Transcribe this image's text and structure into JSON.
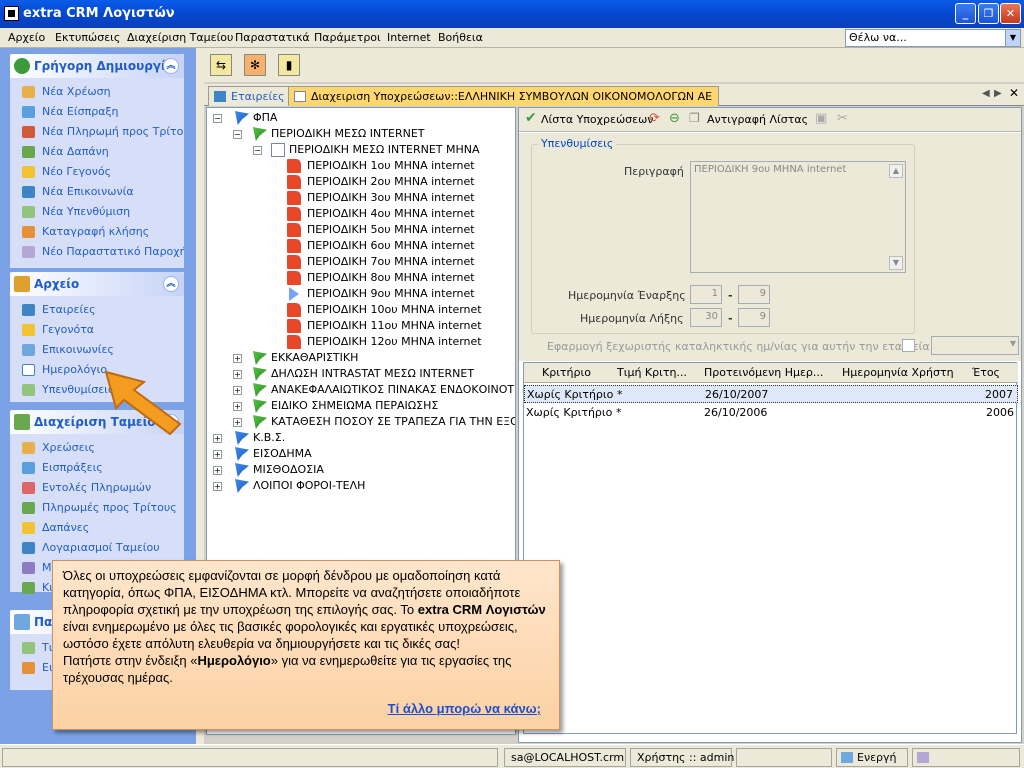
{
  "window": {
    "title": "extra CRM Λογιστών"
  },
  "menu": [
    "Αρχείο",
    "Εκτυπώσεις",
    "Διαχείριση Ταμείου",
    "Παραστατικά",
    "Παράμετροι",
    "Internet",
    "Βοήθεια"
  ],
  "search_combo": {
    "value": "Θέλω να..."
  },
  "panels": {
    "quick": {
      "title": "Γρήγορη Δημιουργία",
      "items": [
        "Νέα Χρέωση",
        "Νέα Είσπραξη",
        "Νέα Πληρωμή προς Τρίτους",
        "Νέα Δαπάνη",
        "Νέο Γεγονός",
        "Νέα Επικοινωνία",
        "Νέα Υπενθύμιση",
        "Καταγραφή κλήσης",
        "Νέο Παραστατικό Παροχής"
      ]
    },
    "archive": {
      "title": "Αρχείο",
      "items": [
        "Εταιρείες",
        "Γεγονότα",
        "Επικοινωνίες",
        "Ημερολόγιο",
        "Υπενθυμίσεις"
      ]
    },
    "treasury": {
      "title": "Διαχείριση Ταμείου",
      "items": [
        "Χρεώσεις",
        "Εισπράξεις",
        "Εντολές Πληρωμών",
        "Πληρωμές προς Τρίτους",
        "Δαπάνες",
        "Λογαριασμοί Ταμείου",
        "Μ",
        "Κι"
      ]
    },
    "fourth": {
      "title": "Πα",
      "items": [
        "Τι",
        "Ει"
      ]
    }
  },
  "tabs": {
    "companies": "Εταιρείες",
    "active": "Διαχειριση Υποχρεώσεων::ΕΛΛΗΝΙΚΗ ΣΥΜΒΟΥΛΩΝ ΟΙΚΟΝΟΜΟΛΟΓΩΝ ΑΕ"
  },
  "tree": {
    "root": "ΦΠΑ",
    "n1": "ΠΕΡΙΟΔΙΚΗ ΜΕΣΩ INTERNET",
    "n2": "ΠΕΡΙΟΔΙΚΗ ΜΕΣΩ INTERNET ΜΗΝΑ",
    "leaves": [
      "ΠΕΡΙΟΔΙΚΗ 1ου ΜΗΝΑ internet",
      "ΠΕΡΙΟΔΙΚΗ 2ου ΜΗΝΑ internet",
      "ΠΕΡΙΟΔΙΚΗ 3ου ΜΗΝΑ internet",
      "ΠΕΡΙΟΔΙΚΗ 4ου ΜΗΝΑ internet",
      "ΠΕΡΙΟΔΙΚΗ 5ου ΜΗΝΑ internet",
      "ΠΕΡΙΟΔΙΚΗ 6ου ΜΗΝΑ internet",
      "ΠΕΡΙΟΔΙΚΗ 7ου ΜΗΝΑ internet",
      "ΠΕΡΙΟΔΙΚΗ 8ου ΜΗΝΑ internet",
      "ΠΕΡΙΟΔΙΚΗ 9ου ΜΗΝΑ internet",
      "ΠΕΡΙΟΔΙΚΗ 10ου ΜΗΝΑ internet",
      "ΠΕΡΙΟΔΙΚΗ 11ου ΜΗΝΑ internet",
      "ΠΕΡΙΟΔΙΚΗ 12ου ΜΗΝΑ internet"
    ],
    "siblings": [
      "ΕΚΚΑΘΑΡΙΣΤΙΚΗ",
      "ΔΗΛΩΣΗ INTRASTAT ΜΕΣΩ INTERNET",
      "ΑΝΑΚΕΦΑΛΑΙΩΤΙΚΟΣ ΠΙΝΑΚΑΣ ΕΝΔΟΚΟΙΝΟΤΙΚΩΝ Σ",
      "ΕΙΔΙΚΟ ΣΗΜΕΙΩΜΑ ΠΕΡΑΙΩΣΗΣ",
      "ΚΑΤΑΘΕΣΗ ΠΟΣΟΥ ΣΕ ΤΡΑΠΕΖΑ ΓΙΑ ΤΗΝ ΕΞΟΦΛΗ"
    ],
    "top": [
      "Κ.Β.Σ.",
      "ΕΙΣΟΔΗΜΑ",
      "ΜΙΣΘΟΔΟΣΙΑ",
      "ΛΟΙΠΟΙ ΦΟΡΟΙ-ΤΕΛΗ"
    ]
  },
  "rtool": {
    "list": "Λίστα Υποχρεώσεων",
    "copy": "Αντιγραφή Λίστας"
  },
  "form": {
    "group_label": "Υπενθυμίσεις",
    "desc_label": "Περιγραφή",
    "desc_value": "ΠΕΡΙΟΔΙΚΗ 9ου ΜΗΝΑ internet",
    "start_label": "Ημερομηνία Έναρξης",
    "start_day": "1",
    "start_month": "9",
    "end_label": "Ημερομηνία Λήξης",
    "end_day": "30",
    "end_month": "9",
    "dash": "-",
    "apply_label": "Εφαρμογή ξεχωριστής καταληκτικής ημ/νίας για αυτήν την εταιρεία"
  },
  "grid": {
    "headers": [
      "Κριτήριο",
      "Τιμή Κριτη...",
      "Προτεινόμενη Ημερ...",
      "Ημερομηνία Χρήστη",
      "Έτος"
    ],
    "rows": [
      [
        "Χωρίς Κριτήριο",
        "*",
        "26/10/2007",
        "",
        "2007"
      ],
      [
        "Χωρίς Κριτήριο",
        "*",
        "26/10/2006",
        "",
        "2006"
      ]
    ]
  },
  "status": {
    "server": "sa@LOCALHOST.crm",
    "user": "Χρήστης :: admin",
    "state": "Ενεργή"
  },
  "callout": {
    "p1": "Όλες οι υποχρεώσεις εμφανίζονται σε μορφή δένδρου με ομαδοποίηση κατά κατηγορία, όπως ΦΠΑ, ΕΙΣΟΔΗΜΑ κτλ. Μπορείτε να αναζητήσετε οποιαδήποτε πληροφορία σχετική με την υποχρέωση της επιλογής σας. Το",
    "bold1": "extra CRM Λογιστών",
    "p2": "είναι ενημερωμένο με όλες τις βασικές φορολογικές και εργατικές υποχρεώσεις, ωστόσο έχετε απόλυτη ελευθερία να δημιουργήσετε και τις δικές σας!",
    "p3a": "Πατήστε στην ένδειξη «",
    "bold2": "Ημερολόγιο",
    "p3b": "» για να ενημερωθείτε για τις εργασίες της τρέχουσας ημέρας.",
    "link": "Τί άλλο μπορώ να κάνω;"
  }
}
